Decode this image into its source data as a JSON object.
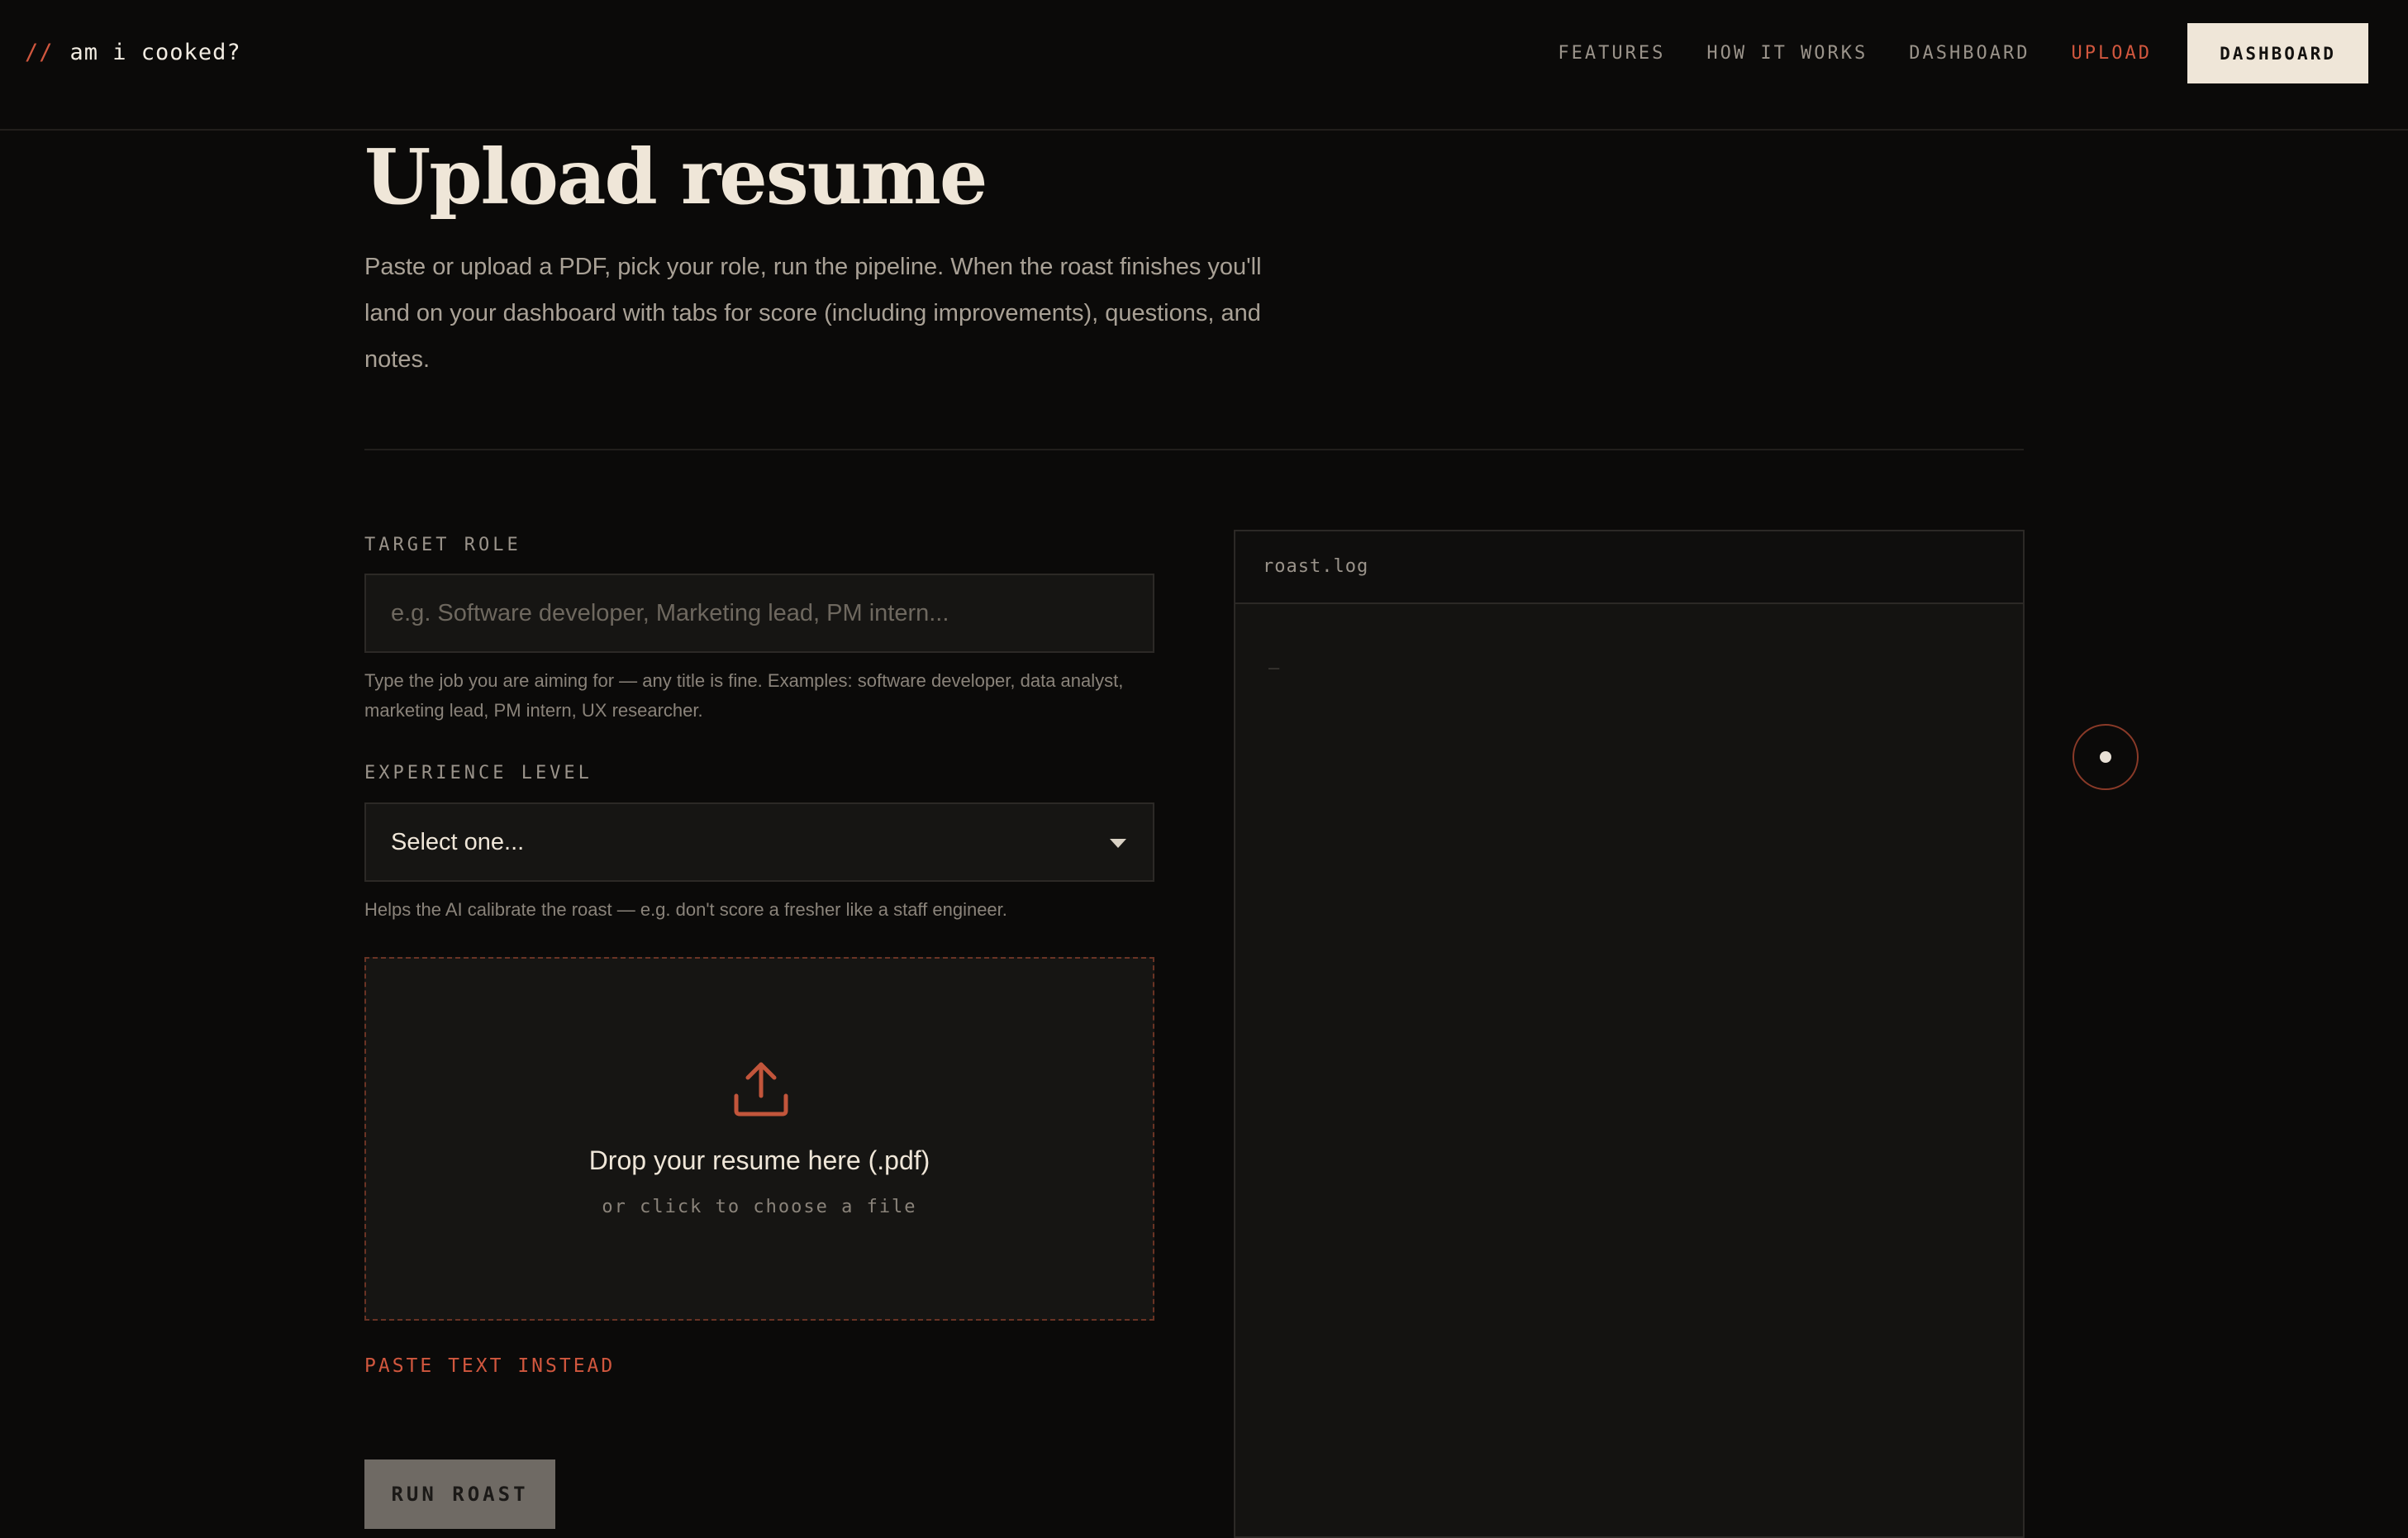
{
  "nav": {
    "logo_prefix": "//",
    "logo_text": "am i cooked?",
    "links": [
      "FEATURES",
      "HOW IT WORKS",
      "DASHBOARD",
      "UPLOAD"
    ],
    "active_link": "UPLOAD",
    "cta_label": "DASHBOARD"
  },
  "header": {
    "title": "Upload resume",
    "lead": "Paste or upload a PDF, pick your role, run the pipeline. When the roast finishes you'll land on your dashboard with tabs for score (including improvements), questions, and notes."
  },
  "form": {
    "target_role": {
      "label": "TARGET ROLE",
      "placeholder": "e.g. Software developer, Marketing lead, PM intern...",
      "value": "",
      "help": "Type the job you are aiming for — any title is fine. Examples: software developer, data analyst, marketing lead, PM intern, UX researcher."
    },
    "experience": {
      "label": "EXPERIENCE LEVEL",
      "selected": "Select one...",
      "help": "Helps the AI calibrate the roast — e.g. don't score a fresher like a staff engineer."
    },
    "dropzone": {
      "title": "Drop your resume here (.pdf)",
      "subtitle": "or click to choose a file"
    },
    "paste_link": "PASTE TEXT INSTEAD",
    "run_label": "RUN ROAST"
  },
  "log": {
    "title": "roast.log",
    "cursor": "_"
  },
  "colors": {
    "accent": "#d1573e",
    "background": "#0b0a09",
    "panel": "#161513",
    "cream": "#efe6d8"
  }
}
